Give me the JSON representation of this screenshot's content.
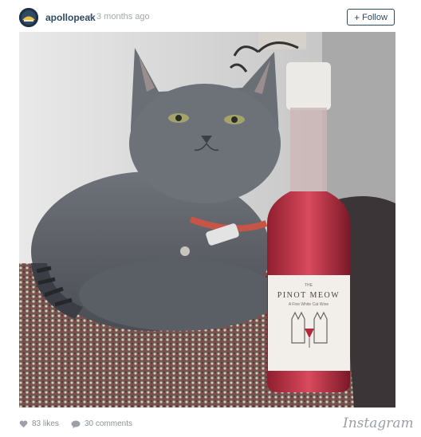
{
  "post": {
    "username": "apollopeak",
    "separator": "•",
    "time_ago": "3 months ago",
    "follow_label": "Follow",
    "follow_icon": "plus-icon"
  },
  "photo": {
    "label_brand": "PINOT MEOW",
    "label_top": "THE",
    "label_sub": "A Fine White Cat Wine"
  },
  "footer": {
    "likes": "83 likes",
    "comments": "30 comments",
    "brand": "Instagram",
    "like_icon": "heart-icon",
    "comment_icon": "speech-bubble-icon"
  },
  "colors": {
    "username": "#2d4a63",
    "follow_border": "#2d4a63",
    "muted": "#8a9096"
  }
}
